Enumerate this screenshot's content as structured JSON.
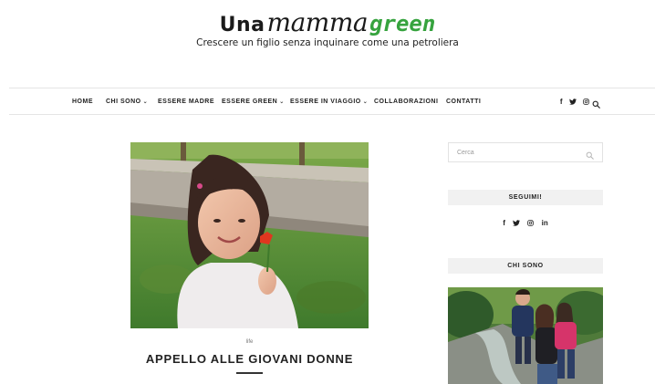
{
  "header": {
    "logo_una": "Una",
    "logo_mamma": "mamma",
    "logo_green": "green",
    "tagline": "Crescere un figlio senza inquinare come una petroliera"
  },
  "nav": {
    "items": [
      {
        "label": "HOME"
      },
      {
        "label": "CHI SONO",
        "dropdown": true
      },
      {
        "label": "ESSERE MADRE"
      },
      {
        "label": "ESSERE GREEN",
        "dropdown": true
      },
      {
        "label": "ESSERE IN VIAGGIO",
        "dropdown": true
      },
      {
        "label": "COLLABORAZIONI"
      },
      {
        "label": "CONTATTI"
      }
    ],
    "caret": "⌄",
    "social": {
      "facebook": "f",
      "twitter": "🐦",
      "instagram": "◎"
    },
    "icons": [
      "facebook-icon",
      "twitter-icon",
      "instagram-icon",
      "search-icon"
    ]
  },
  "post": {
    "category": "life",
    "title": "APPELLO ALLE GIOVANI DONNE"
  },
  "sidebar": {
    "search_placeholder": "Cerca",
    "follow_heading": "SEGUIMI!",
    "social": {
      "facebook": "f",
      "twitter": "🐦",
      "instagram": "◎",
      "linkedin": "in"
    },
    "about_heading": "CHI SONO"
  },
  "colors": {
    "brand_green": "#36a33e",
    "widget_bg": "#f1f1f1",
    "text": "#222222"
  }
}
